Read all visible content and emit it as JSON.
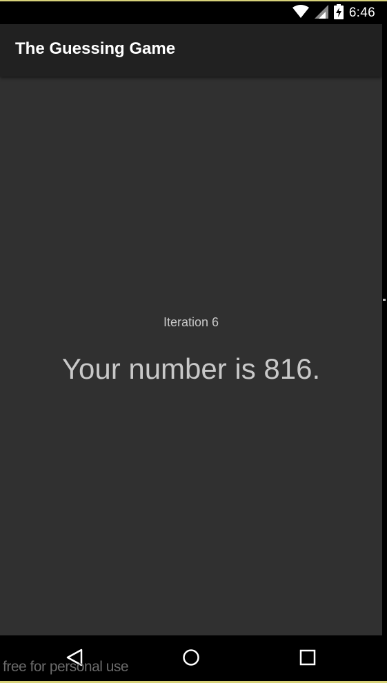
{
  "status_bar": {
    "time": "6:46",
    "icons": [
      "wifi-icon",
      "signal-icon",
      "battery-charging-icon"
    ]
  },
  "app_bar": {
    "title": "The Guessing Game"
  },
  "main": {
    "iteration_label": "Iteration 6",
    "result_text": "Your number is 816."
  },
  "nav_bar": {
    "buttons": [
      "back-icon",
      "home-icon",
      "recents-icon"
    ]
  },
  "watermark": {
    "text": "free for personal use"
  },
  "colors": {
    "status_bar_bg": "#000000",
    "app_bar_bg": "#212121",
    "content_bg": "#303030",
    "text_primary": "#ffffff",
    "text_secondary": "#c8c8c8"
  }
}
